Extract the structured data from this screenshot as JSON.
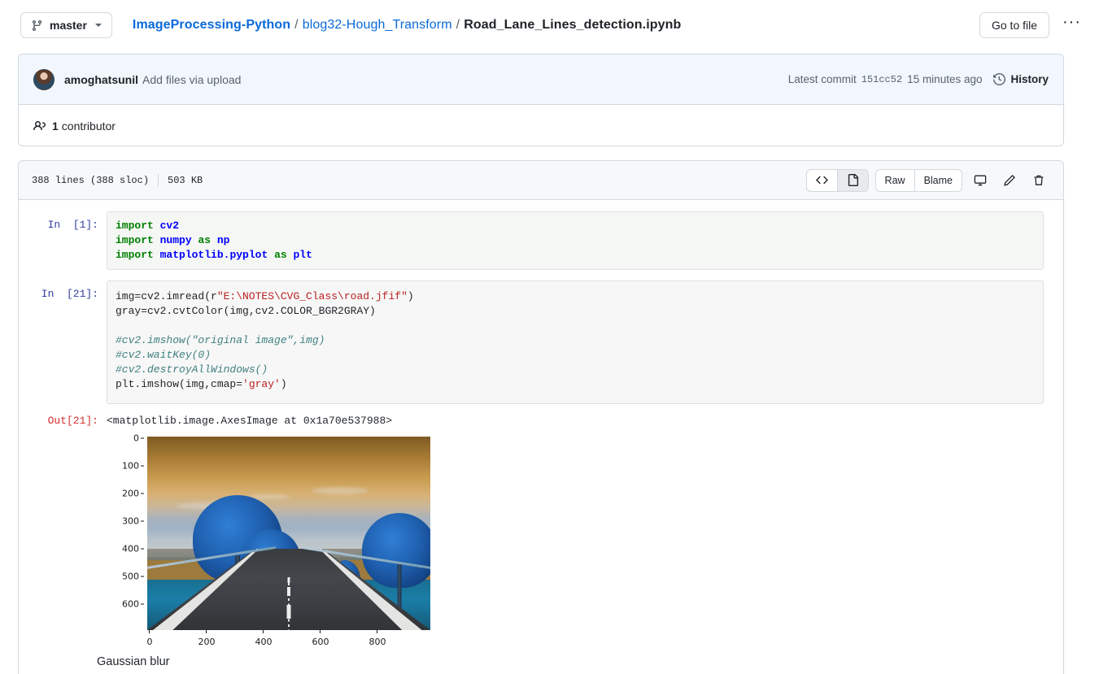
{
  "topbar": {
    "branch": {
      "label": "master",
      "icon": "branch-icon",
      "caret": "chevron-down-icon"
    },
    "breadcrumb": {
      "repo": "ImageProcessing-Python",
      "folder": "blog32-Hough_Transform",
      "file": "Road_Lane_Lines_detection.ipynb",
      "separator": "/"
    },
    "goto_file": "Go to file",
    "kebab": "···"
  },
  "commit": {
    "author": "amoghatsunil",
    "message": "Add files via upload",
    "latest_label": "Latest commit",
    "sha": "151cc52",
    "time": "15 minutes ago",
    "history": "History",
    "contributors_count": "1",
    "contributors_label": "contributor"
  },
  "file_header": {
    "lines": "388 lines (388 sloc)",
    "size": "503 KB",
    "code_view_icon": "code-icon",
    "preview_view_icon": "file-icon",
    "raw": "Raw",
    "blame": "Blame",
    "desktop_icon": "desktop-download-icon",
    "edit_icon": "pencil-icon",
    "delete_icon": "trash-icon"
  },
  "notebook": {
    "cells": [
      {
        "prompt": "In  [1]:",
        "type": "code",
        "lines": [
          [
            {
              "t": "import",
              "c": "k-import"
            },
            {
              "t": " ",
              "c": "k-plain"
            },
            {
              "t": "cv2",
              "c": "k-mod"
            }
          ],
          [
            {
              "t": "import",
              "c": "k-import"
            },
            {
              "t": " ",
              "c": "k-plain"
            },
            {
              "t": "numpy",
              "c": "k-mod"
            },
            {
              "t": " ",
              "c": "k-plain"
            },
            {
              "t": "as",
              "c": "k-as"
            },
            {
              "t": " ",
              "c": "k-plain"
            },
            {
              "t": "np",
              "c": "k-mod"
            }
          ],
          [
            {
              "t": "import",
              "c": "k-import"
            },
            {
              "t": " ",
              "c": "k-plain"
            },
            {
              "t": "matplotlib.pyplot",
              "c": "k-mod"
            },
            {
              "t": " ",
              "c": "k-plain"
            },
            {
              "t": "as",
              "c": "k-as"
            },
            {
              "t": " ",
              "c": "k-plain"
            },
            {
              "t": "plt",
              "c": "k-mod"
            }
          ]
        ]
      },
      {
        "prompt": "In  [21]:",
        "type": "code",
        "lines": [
          [
            {
              "t": "img=cv2.imread(r",
              "c": "k-plain"
            },
            {
              "t": "\"E:\\NOTES\\CVG_Class\\road.jfif\"",
              "c": "k-str"
            },
            {
              "t": ")",
              "c": "k-plain"
            }
          ],
          [
            {
              "t": "gray=cv2.cvtColor(img,cv2.COLOR_BGR2GRAY)",
              "c": "k-plain"
            }
          ],
          [
            {
              "t": "",
              "c": "k-plain"
            }
          ],
          [
            {
              "t": "#cv2.imshow(\"original image\",img)",
              "c": "k-com"
            }
          ],
          [
            {
              "t": "#cv2.waitKey(0)",
              "c": "k-com"
            }
          ],
          [
            {
              "t": "#cv2.destroyAllWindows()",
              "c": "k-com"
            }
          ],
          [
            {
              "t": "plt.imshow(img,cmap=",
              "c": "k-plain"
            },
            {
              "t": "'gray'",
              "c": "k-str"
            },
            {
              "t": ")",
              "c": "k-plain"
            }
          ]
        ]
      }
    ],
    "output": {
      "prompt": "Out[21]:",
      "text": "<matplotlib.image.AxesImage at 0x1a70e537988>"
    },
    "markdown_after": "Gaussian blur"
  },
  "chart_data": {
    "type": "heatmap",
    "title": "",
    "xlabel": "",
    "ylabel": "",
    "description": "matplotlib imshow of a road photograph with BGR channels swapped (blue foliage, orange sky)",
    "xticks": [
      0,
      200,
      400,
      600,
      800
    ],
    "yticks": [
      0,
      100,
      200,
      300,
      400,
      500,
      600
    ],
    "xlim": [
      0,
      960
    ],
    "ylim": [
      660,
      0
    ],
    "grid": false,
    "legend": null
  },
  "colors": {
    "link": "#0969da",
    "text": "#1f2328",
    "muted": "#59636e",
    "border": "#d1d9e0",
    "header_bg": "#f6f8fa",
    "commit_bg": "#f1f7fd",
    "prompt_in": "#303f9f",
    "prompt_out": "#d32f2f",
    "string": "#ba2121",
    "comment": "#408080",
    "keyword": "#008000",
    "module": "#0000ff"
  }
}
